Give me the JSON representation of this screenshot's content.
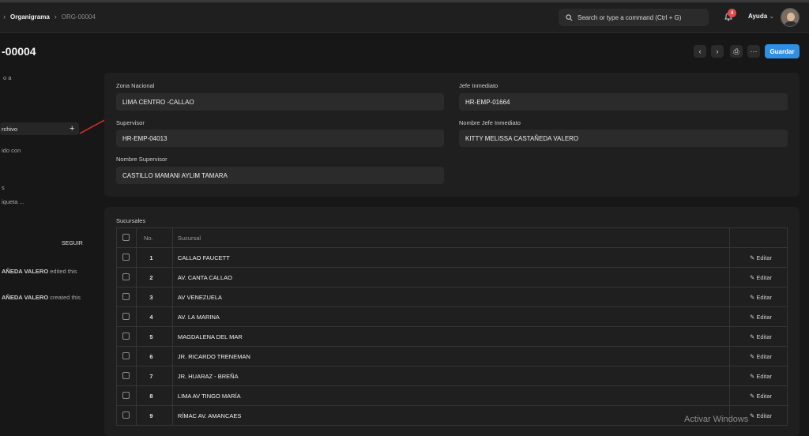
{
  "breadcrumb": {
    "parent": "Organigrama",
    "current": "ORG-00004"
  },
  "search": {
    "placeholder": "Search or type a command (Ctrl + G)"
  },
  "notifications": {
    "count": "4"
  },
  "help": {
    "label": "Ayuda"
  },
  "page": {
    "title": "-00004"
  },
  "actions": {
    "prev": "‹",
    "next": "›",
    "print": "⎙",
    "more": "···",
    "save": "Guardar"
  },
  "sidebar": {
    "assigned": "o a",
    "attachments": "rchivo",
    "shared": "ido con",
    "tags_header": "s",
    "tags_add": "iqueta ...",
    "follow": "SEGUIR",
    "activity": [
      {
        "user": "AÑEDA VALERO",
        "action": "edited this"
      },
      {
        "user": "AÑEDA VALERO",
        "action": "created this"
      }
    ]
  },
  "form": {
    "zona": {
      "label": "Zona Nacional",
      "value": "LIMA CENTRO -CALLAO"
    },
    "jefe": {
      "label": "Jefe Inmediato",
      "value": "HR-EMP-01664"
    },
    "supervisor": {
      "label": "Supervisor",
      "value": "HR-EMP-04013"
    },
    "nombre_jefe": {
      "label": "Nombre Jefe Inmediato",
      "value": "KITTY MELISSA CASTAÑEDA VALERO"
    },
    "nombre_supervisor": {
      "label": "Nombre Supervisor",
      "value": "CASTILLO MAMANI AYLIM TAMARA"
    }
  },
  "sucursales": {
    "title": "Sucursales",
    "col_no": "No.",
    "col_name": "Sucursal",
    "edit_label": "Editar",
    "rows": [
      {
        "no": "1",
        "name": "CALLAO FAUCETT"
      },
      {
        "no": "2",
        "name": "AV. CANTA CALLAO"
      },
      {
        "no": "3",
        "name": "AV VENEZUELA"
      },
      {
        "no": "4",
        "name": "AV. LA MARINA"
      },
      {
        "no": "5",
        "name": "MAGDALENA DEL MAR"
      },
      {
        "no": "6",
        "name": "JR. RICARDO TRENEMAN"
      },
      {
        "no": "7",
        "name": "JR. HUARAZ - BREÑA"
      },
      {
        "no": "8",
        "name": "LIMA AV TINGO MARÍA"
      },
      {
        "no": "9",
        "name": "RÍMAC AV. AMANCAES"
      }
    ]
  },
  "watermark": "Activar Windows",
  "colors": {
    "accent": "#2f8fe4",
    "annotation_arrow": "#d42a2a",
    "badge": "#e24c4c"
  }
}
